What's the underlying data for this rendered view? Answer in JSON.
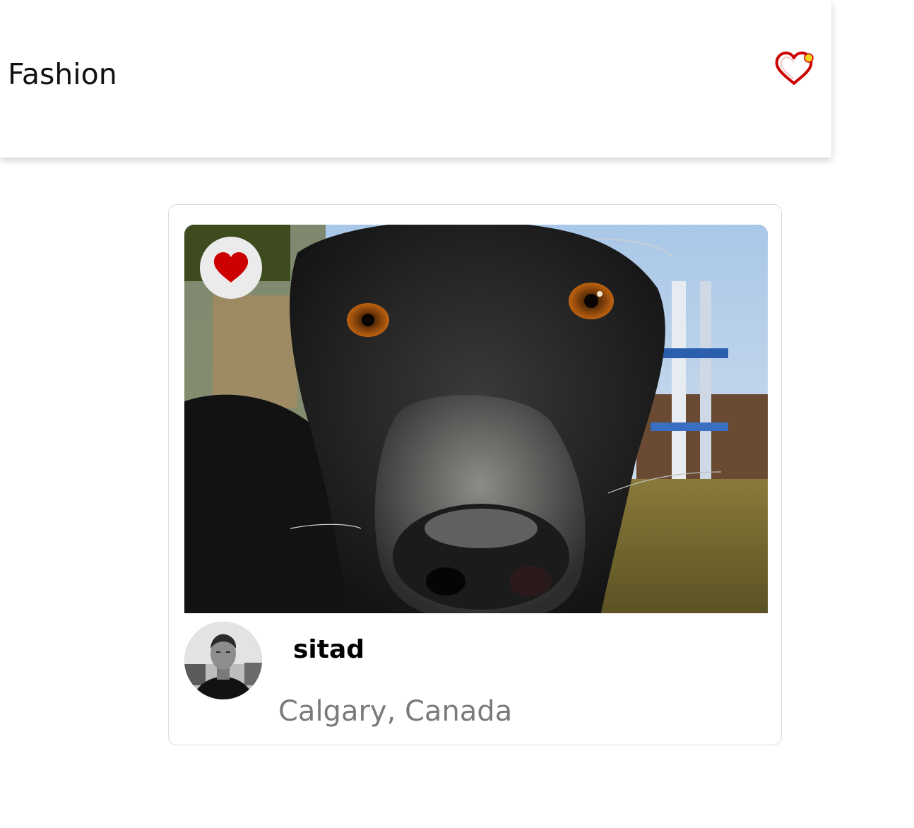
{
  "header": {
    "title": "Fashion",
    "favorites_icon": "heart-outline-icon",
    "notification_dot_color": "#f2d21b",
    "accent_color": "#cc0000"
  },
  "card": {
    "photo_icon": "dog-photo",
    "like_icon": "heart-filled-icon",
    "like_color": "#cc0000",
    "author": {
      "username": "sitad",
      "location": "Calgary, Canada",
      "avatar_icon": "avatar-photo"
    }
  }
}
